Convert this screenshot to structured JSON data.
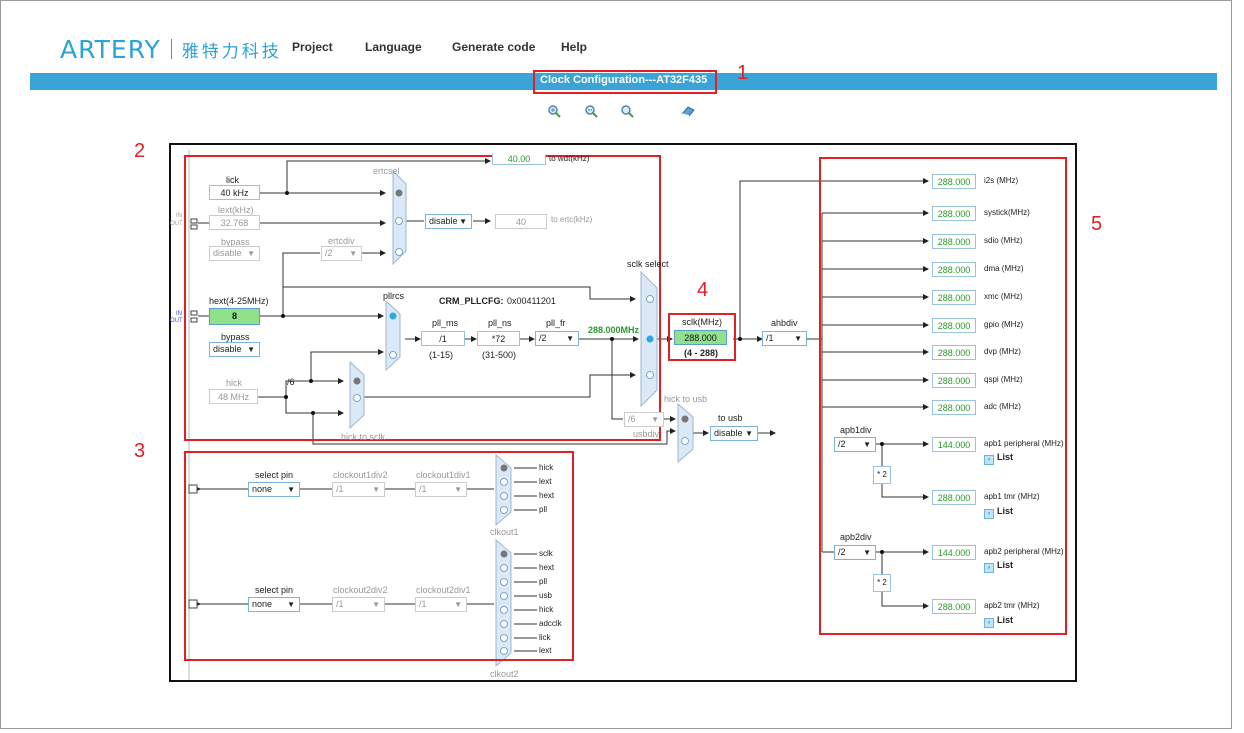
{
  "header": {
    "logo_mark": "ARTERY",
    "logo_cn": "雅特力科技",
    "menu": [
      "Project",
      "Language",
      "Generate code",
      "Help"
    ],
    "title": "Clock Configuration---AT32F435"
  },
  "toolbar": {
    "icons": [
      "zoom-in-icon",
      "zoom-out-icon",
      "zoom-reset-icon",
      "eraser-icon"
    ]
  },
  "callouts": [
    "1",
    "2",
    "3",
    "4",
    "5"
  ],
  "clock_source": {
    "lick_label": "lick",
    "lick_value": "40 kHz",
    "lext_label": "lext(kHz)",
    "lext_value": "32.768",
    "bypass_label": "bypass",
    "bypass_value": "disable",
    "in_out_small": [
      "IN",
      "OUT"
    ],
    "wdt_value": "40.00",
    "wdt_label": "to wdt(kHz)",
    "ertcsel_label": "ertcsel",
    "ertc_enable": "disable",
    "ertc_value": "40",
    "ertc_label": "to ertc(kHz)",
    "ertcdiv_label": "ertcdiv",
    "ertcdiv_value": "/2",
    "hext_label": "hext(4-25MHz)",
    "hext_value": "8",
    "hext_bypass_label": "bypass",
    "hext_bypass_value": "disable",
    "hick_label": "hick",
    "hick_value": "48 MHz",
    "hick_div": "/6",
    "pllrcs_label": "pllrcs",
    "crm_pllcfg_label": "CRM_PLLCFG:",
    "crm_pllcfg_value": "0x00411201",
    "pll_ms_label": "pll_ms",
    "pll_ms_value": "/1",
    "pll_ms_range": "(1-15)",
    "pll_ns_label": "pll_ns",
    "pll_ns_value": "*72",
    "pll_ns_range": "(31-500)",
    "pll_fr_label": "pll_fr",
    "pll_fr_value": "/2",
    "pll_out": "288.000MHz",
    "sclk_select_label": "sclk select",
    "hick_to_sclk_label": "hick to sclk",
    "usbdiv_label": "usbdiv",
    "usbdiv_value": "/6",
    "hick_to_usb_label": "hick to usb",
    "to_usb_label": "to usb",
    "to_usb_value": "disable"
  },
  "sclk": {
    "label": "sclk(MHz)",
    "value": "288.000",
    "range": "(4 - 288)"
  },
  "ahb": {
    "label": "ahbdiv",
    "value": "/1"
  },
  "outputs": [
    {
      "value": "288.000",
      "label": "i2s (MHz)"
    },
    {
      "value": "288.000",
      "label": "systick(MHz)"
    },
    {
      "value": "288.000",
      "label": "sdio (MHz)"
    },
    {
      "value": "288.000",
      "label": "dma (MHz)"
    },
    {
      "value": "288.000",
      "label": "xmc (MHz)"
    },
    {
      "value": "288.000",
      "label": "gpio (MHz)"
    },
    {
      "value": "288.000",
      "label": "dvp (MHz)"
    },
    {
      "value": "288.000",
      "label": "qspi (MHz)"
    },
    {
      "value": "288.000",
      "label": "adc (MHz)"
    }
  ],
  "apb1": {
    "label": "apb1div",
    "value": "/2",
    "mult": "* 2",
    "periph_value": "144.000",
    "periph_label": "apb1 peripheral (MHz)",
    "tmr_value": "288.000",
    "tmr_label": "apb1 tmr (MHz)"
  },
  "apb2": {
    "label": "apb2div",
    "value": "/2",
    "mult": "* 2",
    "periph_value": "144.000",
    "periph_label": "apb2 peripheral (MHz)",
    "tmr_value": "288.000",
    "tmr_label": "apb2 tmr (MHz)"
  },
  "list_label": "List",
  "clkout1": {
    "select_pin_label": "select pin",
    "select_pin_value": "none",
    "div2_label": "clockout1div2",
    "div2_value": "/1",
    "div1_label": "clockout1div1",
    "div1_value": "/1",
    "mux_label": "clkout1",
    "sources": [
      "hick",
      "lext",
      "hext",
      "pll"
    ]
  },
  "clkout2": {
    "select_pin_label": "select pin",
    "select_pin_value": "none",
    "div2_label": "clockout2div2",
    "div2_value": "/1",
    "div1_label": "clockout2div1",
    "div1_value": "/1",
    "mux_label": "clkout2",
    "sources": [
      "sclk",
      "hext",
      "pll",
      "usb",
      "hick",
      "adcclk",
      "lick",
      "lext"
    ]
  }
}
